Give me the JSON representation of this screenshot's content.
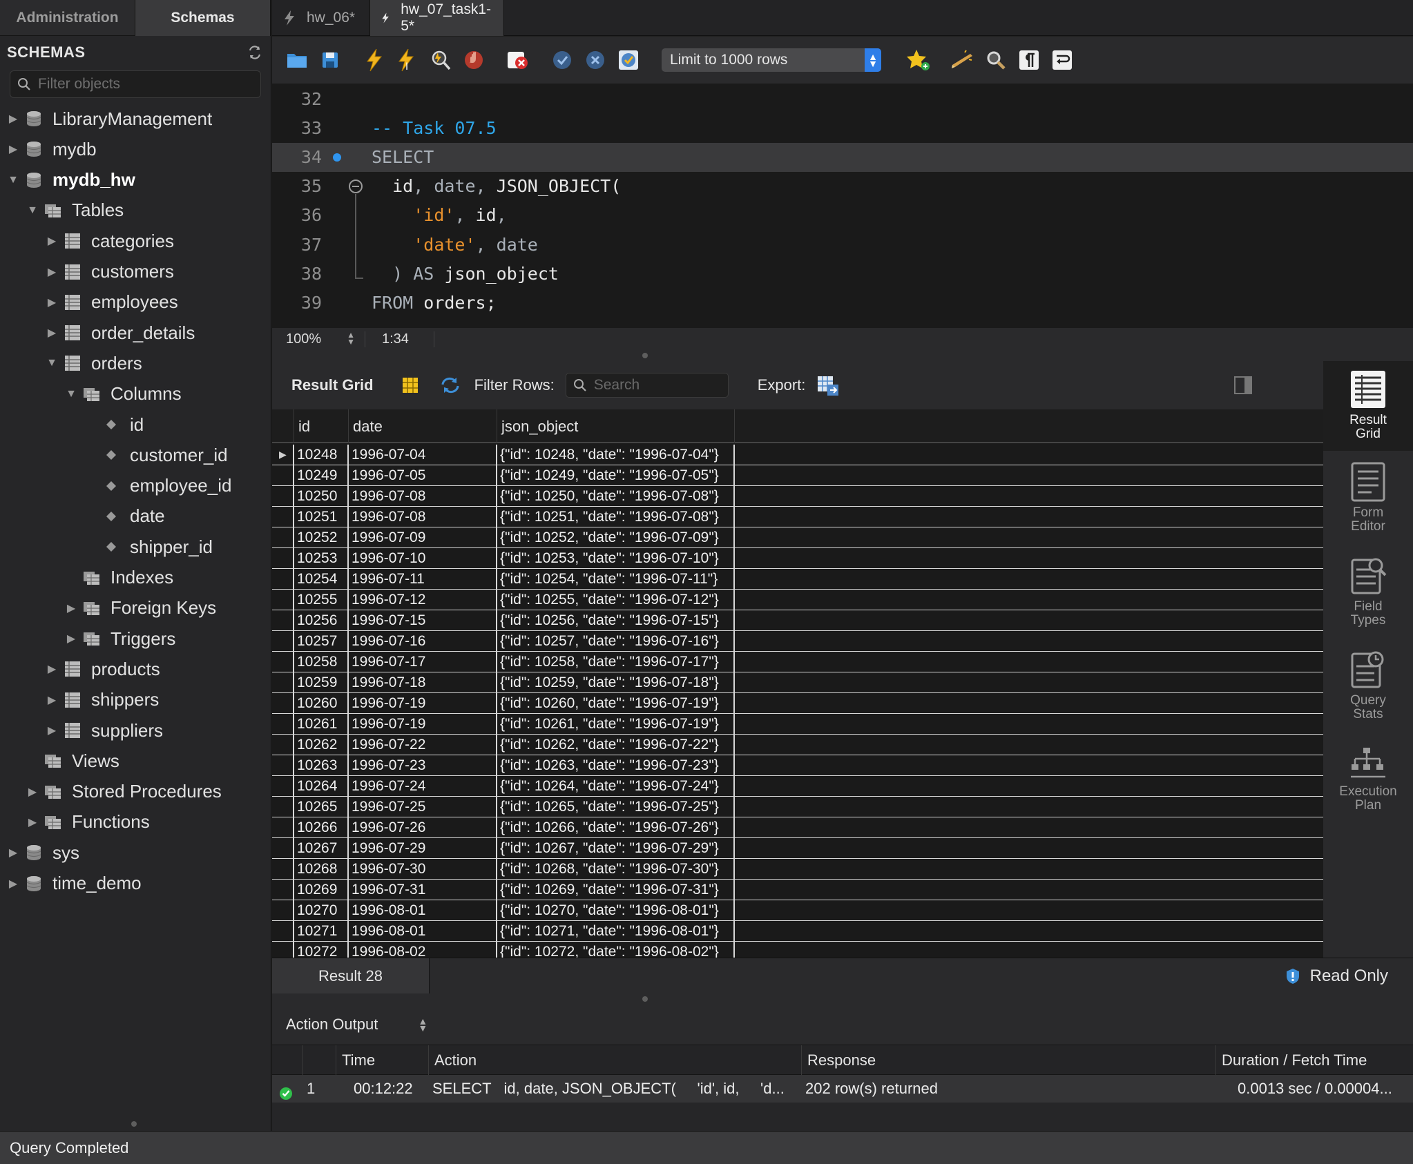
{
  "sidebar": {
    "tabs": [
      "Administration",
      "Schemas"
    ],
    "active_tab": "Schemas",
    "section_title": "SCHEMAS",
    "filter_placeholder": "Filter objects",
    "tree": [
      {
        "label": "LibraryManagement",
        "type": "schema",
        "expanded": false,
        "bold": false
      },
      {
        "label": "mydb",
        "type": "schema",
        "expanded": false,
        "bold": false
      },
      {
        "label": "mydb_hw",
        "type": "schema",
        "expanded": true,
        "bold": true
      },
      {
        "label": "Tables",
        "type": "folder",
        "expanded": true
      },
      {
        "label": "categories",
        "type": "table",
        "expanded": false
      },
      {
        "label": "customers",
        "type": "table",
        "expanded": false
      },
      {
        "label": "employees",
        "type": "table",
        "expanded": false
      },
      {
        "label": "order_details",
        "type": "table",
        "expanded": false
      },
      {
        "label": "orders",
        "type": "table",
        "expanded": true
      },
      {
        "label": "Columns",
        "type": "folder",
        "expanded": true
      },
      {
        "label": "id",
        "type": "column"
      },
      {
        "label": "customer_id",
        "type": "column"
      },
      {
        "label": "employee_id",
        "type": "column"
      },
      {
        "label": "date",
        "type": "column"
      },
      {
        "label": "shipper_id",
        "type": "column"
      },
      {
        "label": "Indexes",
        "type": "folder",
        "expanded": null
      },
      {
        "label": "Foreign Keys",
        "type": "folder",
        "expanded": false
      },
      {
        "label": "Triggers",
        "type": "folder",
        "expanded": false
      },
      {
        "label": "products",
        "type": "table",
        "expanded": false
      },
      {
        "label": "shippers",
        "type": "table",
        "expanded": false
      },
      {
        "label": "suppliers",
        "type": "table",
        "expanded": false
      },
      {
        "label": "Views",
        "type": "folder",
        "expanded": null
      },
      {
        "label": "Stored Procedures",
        "type": "folder",
        "expanded": false
      },
      {
        "label": "Functions",
        "type": "folder",
        "expanded": false
      },
      {
        "label": "sys",
        "type": "schema",
        "expanded": false
      },
      {
        "label": "time_demo",
        "type": "schema",
        "expanded": false
      }
    ]
  },
  "editor_tabs": [
    {
      "label": "hw_06*",
      "active": false
    },
    {
      "label": "hw_07_task1-5*",
      "active": true
    }
  ],
  "toolbar": {
    "limit_label": "Limit to 1000 rows",
    "icons": [
      "open-file-icon",
      "save-icon",
      "execute-icon",
      "execute-current-icon",
      "explain-icon",
      "stop-icon",
      "toggle-error-icon",
      "commit-icon",
      "rollback-icon",
      "autocommit-icon",
      "limit-select",
      "add-snippet-icon",
      "beautify-icon",
      "find-icon",
      "invisible-chars-icon",
      "wrap-icon"
    ]
  },
  "editor": {
    "lines": [
      {
        "num": "32",
        "tokens": []
      },
      {
        "num": "33",
        "tokens": [
          {
            "t": "-- Task 07.5",
            "c": "cmt"
          }
        ]
      },
      {
        "num": "34",
        "tokens": [
          {
            "t": "SELECT",
            "c": "kw"
          }
        ]
      },
      {
        "num": "35",
        "tokens": [
          {
            "t": "  id",
            "c": "txt"
          },
          {
            "t": ", ",
            "c": "kw"
          },
          {
            "t": "date",
            "c": "kw"
          },
          {
            "t": ", ",
            "c": "kw"
          },
          {
            "t": "JSON_OBJECT(",
            "c": "txt"
          }
        ]
      },
      {
        "num": "36",
        "tokens": [
          {
            "t": "    ",
            "c": "txt"
          },
          {
            "t": "'id'",
            "c": "str"
          },
          {
            "t": ", ",
            "c": "kw"
          },
          {
            "t": "id",
            "c": "txt"
          },
          {
            "t": ",",
            "c": "kw"
          }
        ]
      },
      {
        "num": "37",
        "tokens": [
          {
            "t": "    ",
            "c": "txt"
          },
          {
            "t": "'date'",
            "c": "str"
          },
          {
            "t": ", ",
            "c": "kw"
          },
          {
            "t": "date",
            "c": "kw"
          }
        ]
      },
      {
        "num": "38",
        "tokens": [
          {
            "t": "  ) ",
            "c": "kw"
          },
          {
            "t": "AS",
            "c": "kw"
          },
          {
            "t": " json_object",
            "c": "txt"
          }
        ]
      },
      {
        "num": "39",
        "tokens": [
          {
            "t": "FROM",
            "c": "kw"
          },
          {
            "t": " orders;",
            "c": "txt"
          }
        ]
      }
    ],
    "current_line": "34",
    "zoom": "100%",
    "cursor_pos": "1:34"
  },
  "result_toolbar": {
    "title": "Result Grid",
    "filter_label": "Filter Rows:",
    "search_placeholder": "Search",
    "export_label": "Export:"
  },
  "grid": {
    "columns": [
      "id",
      "date",
      "json_object"
    ],
    "rows": [
      [
        "10248",
        "1996-07-04",
        "{\"id\": 10248, \"date\": \"1996-07-04\"}"
      ],
      [
        "10249",
        "1996-07-05",
        "{\"id\": 10249, \"date\": \"1996-07-05\"}"
      ],
      [
        "10250",
        "1996-07-08",
        "{\"id\": 10250, \"date\": \"1996-07-08\"}"
      ],
      [
        "10251",
        "1996-07-08",
        "{\"id\": 10251, \"date\": \"1996-07-08\"}"
      ],
      [
        "10252",
        "1996-07-09",
        "{\"id\": 10252, \"date\": \"1996-07-09\"}"
      ],
      [
        "10253",
        "1996-07-10",
        "{\"id\": 10253, \"date\": \"1996-07-10\"}"
      ],
      [
        "10254",
        "1996-07-11",
        "{\"id\": 10254, \"date\": \"1996-07-11\"}"
      ],
      [
        "10255",
        "1996-07-12",
        "{\"id\": 10255, \"date\": \"1996-07-12\"}"
      ],
      [
        "10256",
        "1996-07-15",
        "{\"id\": 10256, \"date\": \"1996-07-15\"}"
      ],
      [
        "10257",
        "1996-07-16",
        "{\"id\": 10257, \"date\": \"1996-07-16\"}"
      ],
      [
        "10258",
        "1996-07-17",
        "{\"id\": 10258, \"date\": \"1996-07-17\"}"
      ],
      [
        "10259",
        "1996-07-18",
        "{\"id\": 10259, \"date\": \"1996-07-18\"}"
      ],
      [
        "10260",
        "1996-07-19",
        "{\"id\": 10260, \"date\": \"1996-07-19\"}"
      ],
      [
        "10261",
        "1996-07-19",
        "{\"id\": 10261, \"date\": \"1996-07-19\"}"
      ],
      [
        "10262",
        "1996-07-22",
        "{\"id\": 10262, \"date\": \"1996-07-22\"}"
      ],
      [
        "10263",
        "1996-07-23",
        "{\"id\": 10263, \"date\": \"1996-07-23\"}"
      ],
      [
        "10264",
        "1996-07-24",
        "{\"id\": 10264, \"date\": \"1996-07-24\"}"
      ],
      [
        "10265",
        "1996-07-25",
        "{\"id\": 10265, \"date\": \"1996-07-25\"}"
      ],
      [
        "10266",
        "1996-07-26",
        "{\"id\": 10266, \"date\": \"1996-07-26\"}"
      ],
      [
        "10267",
        "1996-07-29",
        "{\"id\": 10267, \"date\": \"1996-07-29\"}"
      ],
      [
        "10268",
        "1996-07-30",
        "{\"id\": 10268, \"date\": \"1996-07-30\"}"
      ],
      [
        "10269",
        "1996-07-31",
        "{\"id\": 10269, \"date\": \"1996-07-31\"}"
      ],
      [
        "10270",
        "1996-08-01",
        "{\"id\": 10270, \"date\": \"1996-08-01\"}"
      ],
      [
        "10271",
        "1996-08-01",
        "{\"id\": 10271, \"date\": \"1996-08-01\"}"
      ],
      [
        "10272",
        "1996-08-02",
        "{\"id\": 10272, \"date\": \"1996-08-02\"}"
      ]
    ]
  },
  "side_panel": [
    {
      "label_1": "Result",
      "label_2": "Grid",
      "icon": "result-grid-icon",
      "active": true
    },
    {
      "label_1": "Form",
      "label_2": "Editor",
      "icon": "form-editor-icon",
      "active": false
    },
    {
      "label_1": "Field",
      "label_2": "Types",
      "icon": "field-types-icon",
      "active": false
    },
    {
      "label_1": "Query",
      "label_2": "Stats",
      "icon": "query-stats-icon",
      "active": false
    },
    {
      "label_1": "Execution",
      "label_2": "Plan",
      "icon": "execution-plan-icon",
      "active": false
    }
  ],
  "result_tabs": {
    "tab_label": "Result 28",
    "read_only": "Read Only"
  },
  "action_output": {
    "title": "Action Output",
    "columns": [
      "Time",
      "Action",
      "Response",
      "Duration / Fetch Time"
    ],
    "rows": [
      {
        "status": "success",
        "num": "1",
        "time": "00:12:22",
        "action": "SELECT   id, date, JSON_OBJECT(     'id', id,     'd...",
        "response": "202 row(s) returned",
        "duration": "0.0013 sec / 0.00004..."
      }
    ]
  },
  "status_bar": "Query Completed",
  "colors": {
    "accent": "#2f7ee8",
    "comment": "#2fa6e8",
    "string": "#e8912d",
    "success": "#2fbf4a"
  }
}
